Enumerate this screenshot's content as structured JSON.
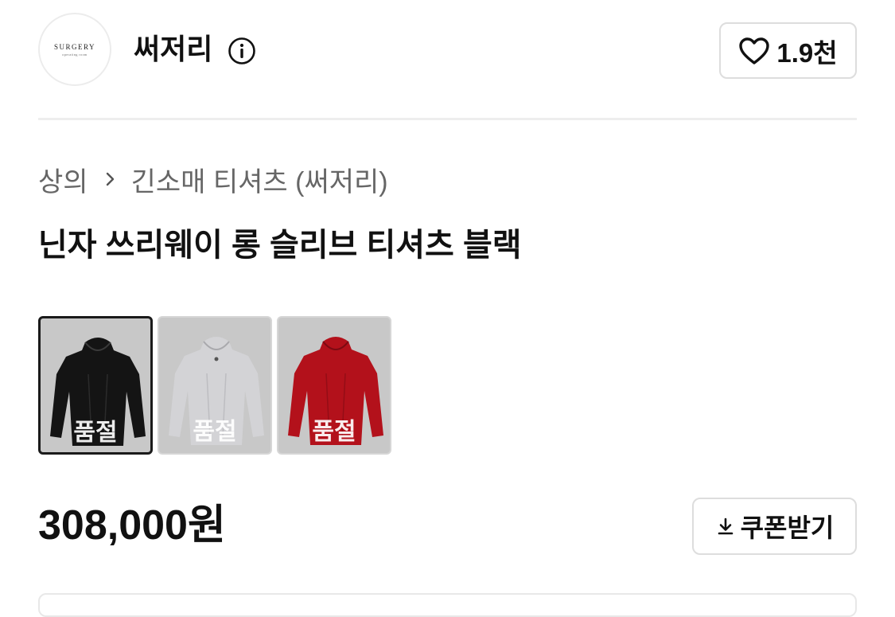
{
  "brand": {
    "logo_text": "SURGERY",
    "logo_subtext": "operating room",
    "name": "써저리",
    "info_icon": "info-circle-icon"
  },
  "like": {
    "icon": "heart-outline-icon",
    "count": "1.9천"
  },
  "breadcrumb": {
    "category": "상의",
    "subcategory": "긴소매 티셔츠 (써저리)",
    "separator_icon": "chevron-right-icon"
  },
  "product": {
    "title": "닌자 쓰리웨이 롱 슬리브 티셔츠 블랙",
    "price": "308,000원"
  },
  "colors": {
    "selected_index": 0,
    "options": [
      {
        "name": "black",
        "hex": "#141414",
        "status": "품절"
      },
      {
        "name": "gray",
        "hex": "#d3d3d6",
        "status": "품절"
      },
      {
        "name": "red",
        "hex": "#b3111b",
        "status": "품절"
      }
    ]
  },
  "coupon": {
    "icon": "download-icon",
    "label": "쿠폰받기"
  }
}
